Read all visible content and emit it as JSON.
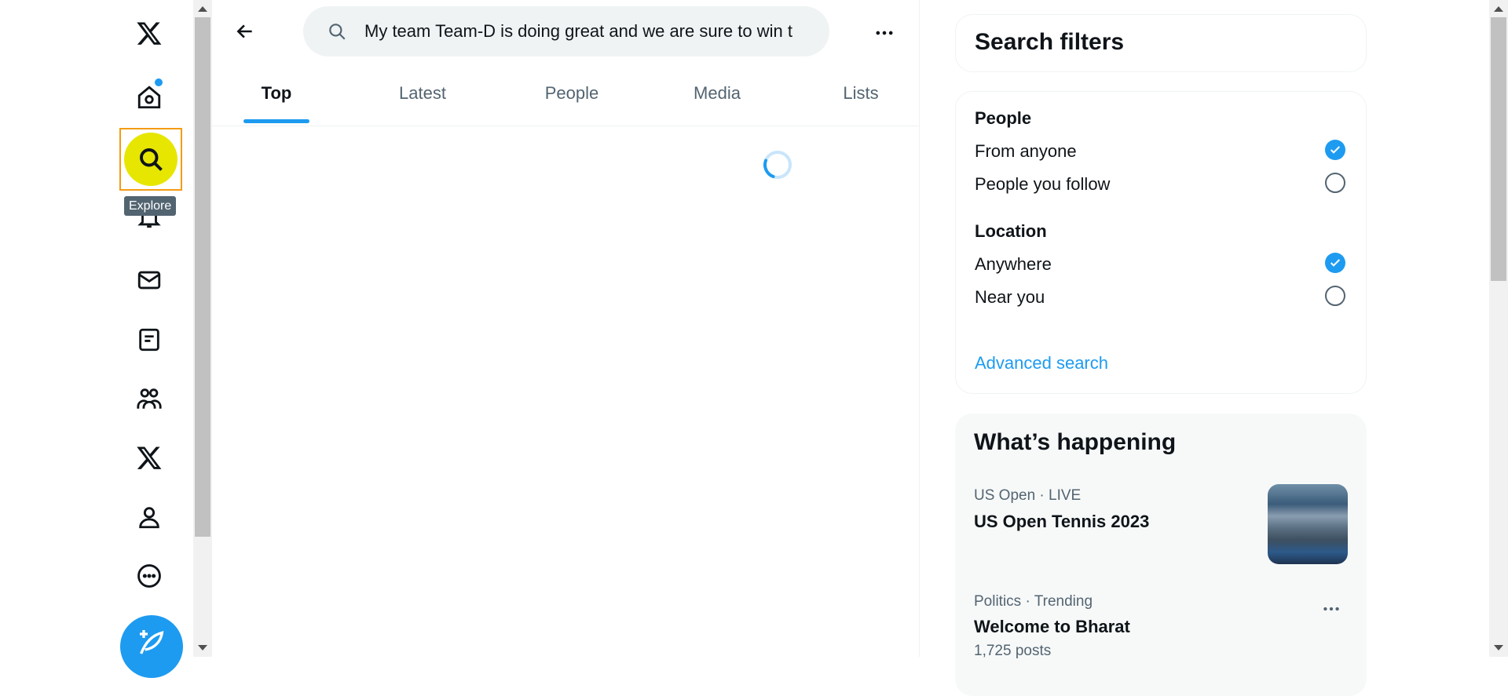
{
  "nav": {
    "tooltip": "Explore",
    "items": [
      "x-logo-icon",
      "home-icon",
      "explore-icon",
      "notifications-icon",
      "messages-icon",
      "lists-icon",
      "communities-icon",
      "premium-icon",
      "profile-icon",
      "more-icon",
      "compose-icon"
    ]
  },
  "search": {
    "value": "My team Team-D is doing great and we are sure to win t"
  },
  "tabs": [
    {
      "label": "Top"
    },
    {
      "label": "Latest"
    },
    {
      "label": "People"
    },
    {
      "label": "Media"
    },
    {
      "label": "Lists"
    }
  ],
  "filters": {
    "title": "Search filters",
    "people_label": "People",
    "people_options": [
      {
        "label": "From anyone",
        "selected": true
      },
      {
        "label": "People you follow",
        "selected": false
      }
    ],
    "location_label": "Location",
    "location_options": [
      {
        "label": "Anywhere",
        "selected": true
      },
      {
        "label": "Near you",
        "selected": false
      }
    ],
    "advanced_link": "Advanced search"
  },
  "whats_happening": {
    "title": "What’s happening",
    "items": [
      {
        "meta": "US Open · LIVE",
        "topic": "US Open Tennis 2023"
      },
      {
        "meta": "Politics · Trending",
        "topic": "Welcome to Bharat",
        "count": "1,725 posts"
      }
    ]
  },
  "colors": {
    "accent": "#1d9bf0",
    "highlight": "#e6e600",
    "highlight_border": "#f39c12"
  }
}
